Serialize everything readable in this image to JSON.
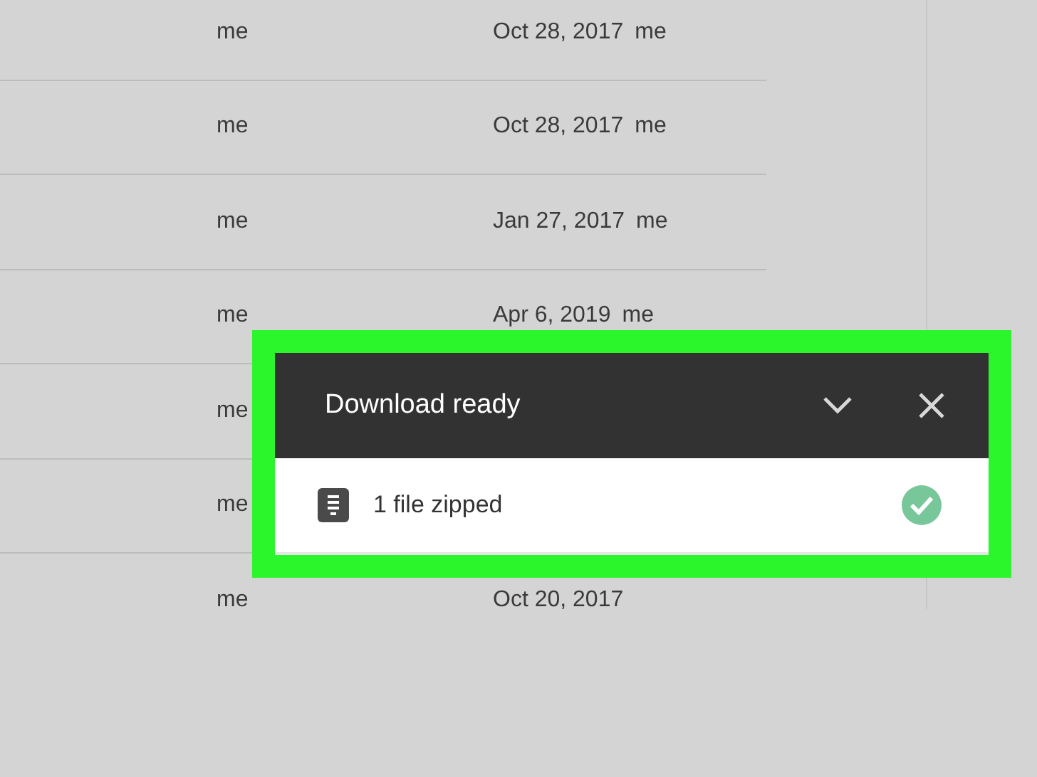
{
  "file_list": {
    "rows": [
      {
        "owner": "me",
        "modified": "Oct 28, 2017",
        "modified_by": "me"
      },
      {
        "owner": "me",
        "modified": "Oct 28, 2017",
        "modified_by": "me"
      },
      {
        "owner": "me",
        "modified": "Jan 27, 2017",
        "modified_by": "me"
      },
      {
        "owner": "me",
        "modified": "Apr 6, 2019",
        "modified_by": "me"
      },
      {
        "owner": "me"
      },
      {
        "owner": "me"
      },
      {
        "owner": "me",
        "modified": "Oct 20, 2017"
      }
    ]
  },
  "download_panel": {
    "title": "Download ready",
    "expanded": true,
    "items": [
      {
        "label": "1 file zipped",
        "done": true
      }
    ]
  }
}
